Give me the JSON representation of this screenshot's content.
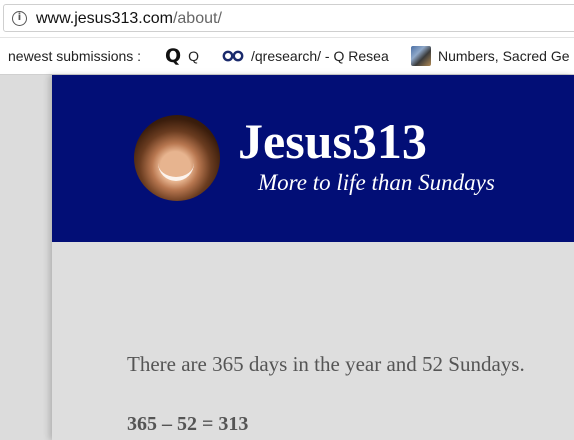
{
  "browser": {
    "url_host": "www.jesus313.com",
    "url_path": "/about/",
    "bookmarks": [
      {
        "label": "newest submissions :",
        "icon": "none"
      },
      {
        "label": "Q",
        "icon": "q-logo-icon"
      },
      {
        "label": "/qresearch/ - Q Resea",
        "icon": "glasses-icon"
      },
      {
        "label": "Numbers, Sacred Ge",
        "icon": "thumbnail-icon"
      }
    ]
  },
  "site": {
    "title": "Jesus313",
    "tagline": "More to life than Sundays"
  },
  "content": {
    "paragraph_1": "There are 365 days in the year and 52 Sundays.",
    "paragraph_2": "365 – 52 = 313"
  },
  "colors": {
    "banner": "#020e76",
    "page_bg": "#dedede",
    "text": "#555555"
  }
}
